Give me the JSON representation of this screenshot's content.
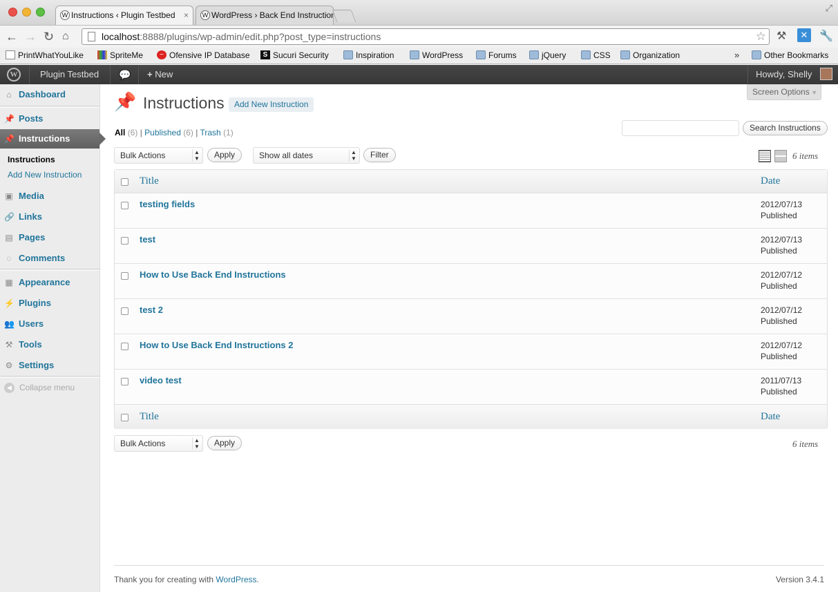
{
  "browser": {
    "tabs": [
      {
        "title": "Instructions ‹ Plugin Testbed",
        "close": "×"
      },
      {
        "title": "WordPress › Back End Instructions",
        "close": "×"
      }
    ],
    "url_host": "localhost",
    "url_rest": ":8888/plugins/wp-admin/edit.php?post_type=instructions",
    "bookmarks": [
      {
        "label": "PrintWhatYouLike",
        "icon": "page-icon"
      },
      {
        "label": "SpriteMe",
        "icon": "spriteme-icon"
      },
      {
        "label": "Ofensive IP Database",
        "icon": "no-entry-icon"
      },
      {
        "label": "Sucuri Security",
        "icon": "sucuri-icon"
      },
      {
        "label": "Inspiration",
        "icon": "folder-icon"
      },
      {
        "label": "WordPress",
        "icon": "folder-icon"
      },
      {
        "label": "Forums",
        "icon": "folder-icon"
      },
      {
        "label": "jQuery",
        "icon": "folder-icon"
      },
      {
        "label": "CSS",
        "icon": "folder-icon"
      },
      {
        "label": "Organization",
        "icon": "folder-icon"
      }
    ],
    "other_bookmarks": "Other Bookmarks",
    "more_glyph": "»"
  },
  "adminbar": {
    "site_name": "Plugin Testbed",
    "new_label": "New",
    "howdy": "Howdy, Shelly"
  },
  "sidebar": {
    "items": [
      {
        "label": "Dashboard",
        "icon": "dashboard-icon"
      },
      {
        "label": "Posts",
        "icon": "pin-icon"
      },
      {
        "label": "Instructions",
        "icon": "pin-icon"
      },
      {
        "label": "Media",
        "icon": "media-icon"
      },
      {
        "label": "Links",
        "icon": "link-icon"
      },
      {
        "label": "Pages",
        "icon": "pages-icon"
      },
      {
        "label": "Comments",
        "icon": "comment-icon"
      },
      {
        "label": "Appearance",
        "icon": "appearance-icon"
      },
      {
        "label": "Plugins",
        "icon": "plugin-icon"
      },
      {
        "label": "Users",
        "icon": "users-icon"
      },
      {
        "label": "Tools",
        "icon": "tools-icon"
      },
      {
        "label": "Settings",
        "icon": "settings-icon"
      }
    ],
    "submenu": [
      {
        "label": "Instructions"
      },
      {
        "label": "Add New Instruction"
      }
    ],
    "collapse_label": "Collapse menu"
  },
  "main": {
    "screen_options": "Screen Options",
    "title": "Instructions",
    "add_new": "Add New Instruction",
    "views": {
      "all": "All",
      "all_count": "(6)",
      "published": "Published",
      "published_count": "(6)",
      "trash": "Trash",
      "trash_count": "(1)",
      "sep": "|"
    },
    "search_button": "Search Instructions",
    "bulk_actions": "Bulk Actions",
    "apply": "Apply",
    "dates_filter": "Show all dates",
    "filter": "Filter",
    "items_count": "6 items",
    "columns": {
      "title": "Title",
      "date": "Date"
    },
    "rows": [
      {
        "title": "testing fields",
        "date": "2012/07/13",
        "status": "Published"
      },
      {
        "title": "test",
        "date": "2012/07/13",
        "status": "Published"
      },
      {
        "title": "How to Use Back End Instructions",
        "date": "2012/07/12",
        "status": "Published"
      },
      {
        "title": "test 2",
        "date": "2012/07/12",
        "status": "Published"
      },
      {
        "title": "How to Use Back End Instructions 2",
        "date": "2012/07/12",
        "status": "Published"
      },
      {
        "title": "video test",
        "date": "2011/07/13",
        "status": "Published"
      }
    ]
  },
  "footer": {
    "thanks_prefix": "Thank you for creating with ",
    "wordpress_link": "WordPress",
    "thanks_suffix": ".",
    "version": "Version 3.4.1"
  },
  "colors": {
    "link": "#21759b",
    "adminbar": "#464646",
    "sidebar": "#ececec"
  }
}
